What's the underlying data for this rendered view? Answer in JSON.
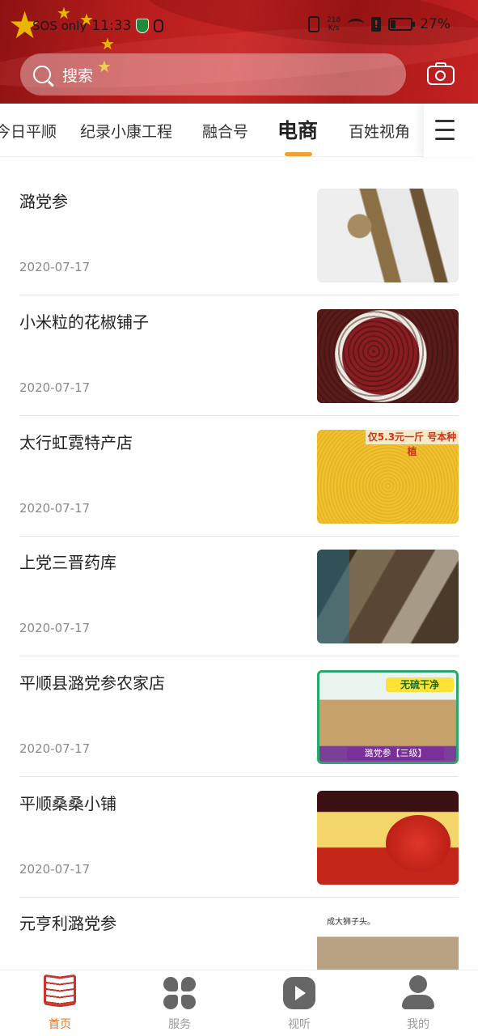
{
  "status_bar": {
    "carrier": "SOS only",
    "time": "11:33",
    "net_speed_value": "218",
    "net_speed_unit": "K/s",
    "battery": "27%",
    "battery_level": 0.27
  },
  "search": {
    "placeholder": "搜索"
  },
  "tabs": [
    {
      "label": "今日平顺",
      "active": false
    },
    {
      "label": "纪录小康工程",
      "active": false
    },
    {
      "label": "融合号",
      "active": false
    },
    {
      "label": "电商",
      "active": true
    },
    {
      "label": "百姓视角",
      "active": false
    }
  ],
  "list": [
    {
      "title": "潞党参",
      "date": "2020-07-17"
    },
    {
      "title": "小米粒的花椒铺子",
      "date": "2020-07-17"
    },
    {
      "title": "太行虹霓特产店",
      "date": "2020-07-17",
      "image_text": "仅5.3元一斤 号本种植"
    },
    {
      "title": "上党三晋药库",
      "date": "2020-07-17"
    },
    {
      "title": "平顺县潞党参农家店",
      "date": "2020-07-17",
      "image_tag": "无硫干净",
      "image_footer": "潞党参【三级】"
    },
    {
      "title": "平顺桑桑小铺",
      "date": "2020-07-17"
    },
    {
      "title": "元亨利潞党参",
      "date": "",
      "image_caption": "成大狮子头。"
    }
  ],
  "bottom_nav": [
    {
      "label": "首页",
      "icon": "book-icon",
      "active": true
    },
    {
      "label": "服务",
      "icon": "grid-icon",
      "active": false
    },
    {
      "label": "视听",
      "icon": "play-icon",
      "active": false
    },
    {
      "label": "我的",
      "icon": "user-icon",
      "active": false
    }
  ],
  "colors": {
    "header_red": "#c62424",
    "accent_orange": "#f0a030",
    "active_nav": "#e07a2a",
    "active_icon": "#c7362a"
  }
}
